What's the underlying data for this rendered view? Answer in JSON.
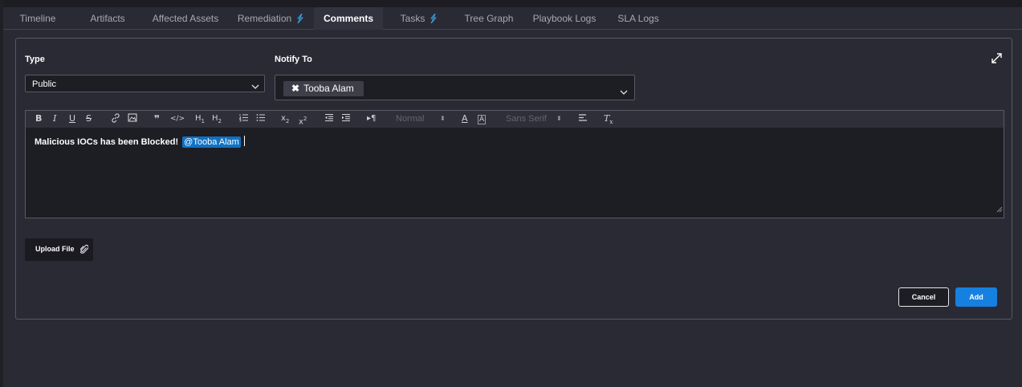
{
  "tabs": [
    {
      "label": "Timeline"
    },
    {
      "label": "Artifacts"
    },
    {
      "label": "Affected Assets"
    },
    {
      "label": "Remediation",
      "icon": "lightning-icon"
    },
    {
      "label": "Comments",
      "active": true
    },
    {
      "label": "Tasks",
      "icon": "lightning-icon"
    },
    {
      "label": "Tree Graph"
    },
    {
      "label": "Playbook Logs"
    },
    {
      "label": "SLA Logs"
    }
  ],
  "form": {
    "type_label": "Type",
    "type_value": "Public",
    "notify_label": "Notify To",
    "notify_chip": "Tooba Alam"
  },
  "toolbar": {
    "header_value": "Normal",
    "font_value": "Sans Serif"
  },
  "editor": {
    "text": "Malicious IOCs has been Blocked!",
    "mention": "@Tooba Alam"
  },
  "actions": {
    "upload_label": "Upload File",
    "cancel_label": "Cancel",
    "add_label": "Add"
  },
  "colors": {
    "accent": "#1580e0",
    "mention": "#1072c4",
    "background": "#2a2a35"
  }
}
